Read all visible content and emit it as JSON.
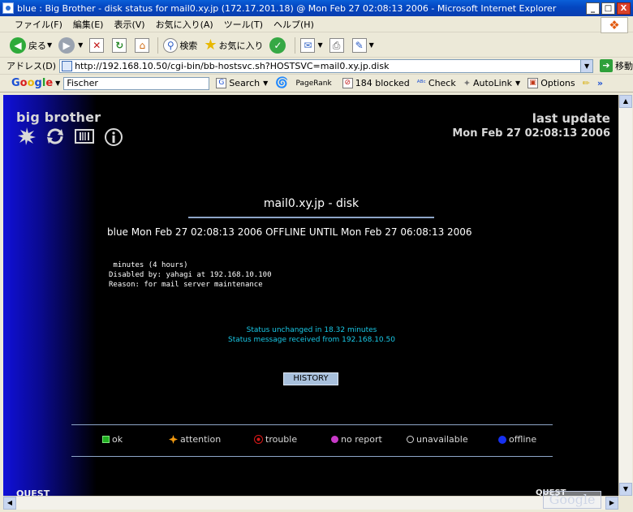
{
  "window": {
    "title": "blue : Big Brother - disk status for mail0.xy.jp (172.17.201.18) @ Mon Feb 27 02:08:13 2006 - Microsoft Internet Explorer",
    "minimize": "_",
    "maximize": "□",
    "close": "X"
  },
  "menubar": {
    "items": [
      "ファイル(F)",
      "編集(E)",
      "表示(V)",
      "お気に入り(A)",
      "ツール(T)",
      "ヘルプ(H)"
    ]
  },
  "toolbar": {
    "back_label": "戻る",
    "search_label": "検索",
    "favorites_label": "お気に入り"
  },
  "address": {
    "label": "アドレス(D)",
    "url": "http://192.168.10.50/cgi-bin/bb-hostsvc.sh?HOSTSVC=mail0.xy.jp.disk",
    "go_label": "移動"
  },
  "googlebar": {
    "search_value": "Fischer",
    "search_label": "Search",
    "pagerank_label": "PageRank",
    "blocked_label": "184 blocked",
    "check_label": "Check",
    "autolink_label": "AutoLink",
    "options_label": "Options",
    "more_label": "»"
  },
  "page": {
    "brand": "big brother",
    "last_update_label": "last update",
    "last_update_time": "Mon Feb 27 02:08:13 2006",
    "host_title": "mail0.xy.jp - disk",
    "status_line": "blue Mon Feb 27 02:08:13 2006 OFFLINE UNTIL Mon Feb 27 06:08:13 2006",
    "details": [
      " minutes (4 hours)",
      "Disabled by: yahagi at 192.168.10.100",
      "Reason: for mail server maintenance"
    ],
    "unchanged": "Status unchanged in 18.32 minutes",
    "received": "Status message received from 192.168.10.50",
    "history_button": "HISTORY",
    "legend": {
      "ok": "ok",
      "attention": "attention",
      "trouble": "trouble",
      "no_report": "no report",
      "unavailable": "unavailable",
      "offline": "offline"
    },
    "quest_left": "QUEST",
    "quest_right": "QUEST"
  },
  "watermark": "Google",
  "colors": {
    "ok": "#22b022",
    "attention": "#f39a10",
    "trouble": "#d81818",
    "no_report": "#c83ac8",
    "offline": "#1630f0",
    "cyan_text": "#19c8e6"
  }
}
